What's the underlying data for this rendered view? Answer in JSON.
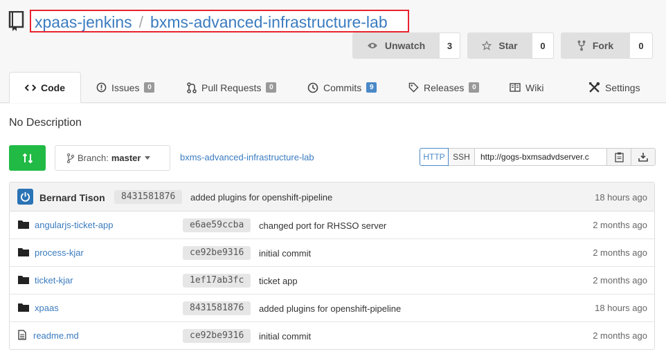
{
  "repo": {
    "owner": "xpaas-jenkins",
    "separator": "/",
    "name": "bxms-advanced-infrastructure-lab"
  },
  "actions": {
    "watch": {
      "label": "Unwatch",
      "count": "3"
    },
    "star": {
      "label": "Star",
      "count": "0"
    },
    "fork": {
      "label": "Fork",
      "count": "0"
    }
  },
  "tabs": [
    {
      "label": "Code",
      "badge": ""
    },
    {
      "label": "Issues",
      "badge": "0"
    },
    {
      "label": "Pull Requests",
      "badge": "0"
    },
    {
      "label": "Commits",
      "badge": "9"
    },
    {
      "label": "Releases",
      "badge": "0"
    },
    {
      "label": "Wiki",
      "badge": ""
    },
    {
      "label": "Settings",
      "badge": ""
    }
  ],
  "description": "No Description",
  "toolbar": {
    "branch_prefix": "Branch:",
    "branch": "master",
    "repo_link": "bxms-advanced-infrastructure-lab",
    "clone_http": "HTTP",
    "clone_ssh": "SSH",
    "clone_url": "http://gogs-bxmsadvdserver.c"
  },
  "latest_commit": {
    "author": "Bernard Tison",
    "sha": "8431581876",
    "message": "added plugins for openshift-pipeline",
    "ago": "18 hours ago"
  },
  "files": [
    {
      "name": "angularjs-ticket-app",
      "type": "dir",
      "sha": "e6ae59ccba",
      "message": "changed port for RHSSO server",
      "ago": "2 months ago"
    },
    {
      "name": "process-kjar",
      "type": "dir",
      "sha": "ce92be9316",
      "message": "initial commit",
      "ago": "2 months ago"
    },
    {
      "name": "ticket-kjar",
      "type": "dir",
      "sha": "1ef17ab3fc",
      "message": "ticket app",
      "ago": "2 months ago"
    },
    {
      "name": "xpaas",
      "type": "dir",
      "sha": "8431581876",
      "message": "added plugins for openshift-pipeline",
      "ago": "18 hours ago"
    },
    {
      "name": "readme.md",
      "type": "file",
      "sha": "ce92be9316",
      "message": "initial commit",
      "ago": "2 months ago"
    }
  ],
  "colors": {
    "link": "#3a7bbf",
    "highlight_border": "#e8232e",
    "sync_green": "#21ba45",
    "commit_badge": "#4a89c8"
  }
}
